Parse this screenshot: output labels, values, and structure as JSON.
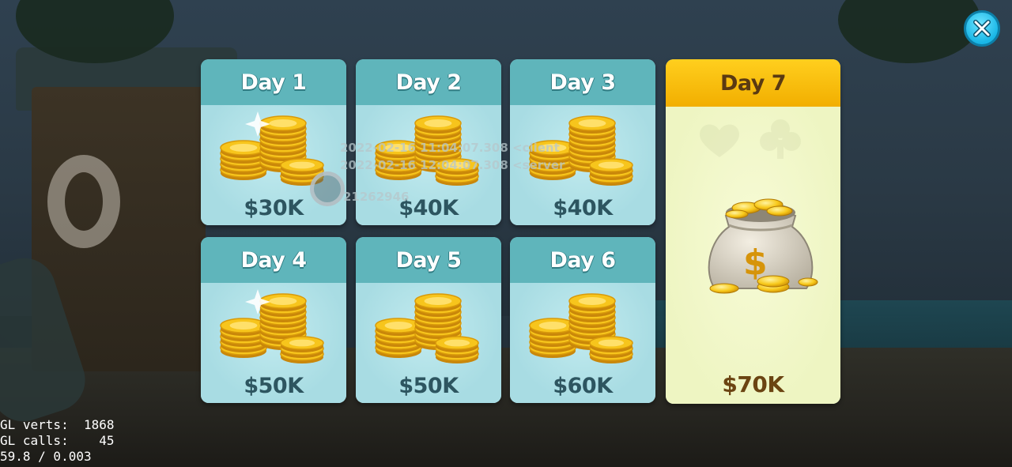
{
  "rewards": [
    {
      "day_label": "Day 1",
      "amount": "$30K"
    },
    {
      "day_label": "Day 2",
      "amount": "$40K"
    },
    {
      "day_label": "Day 3",
      "amount": "$40K"
    },
    {
      "day_label": "Day 4",
      "amount": "$50K"
    },
    {
      "day_label": "Day 5",
      "amount": "$50K"
    },
    {
      "day_label": "Day 6",
      "amount": "$60K"
    }
  ],
  "bonus_reward": {
    "day_label": "Day 7",
    "amount": "$70K"
  },
  "debug": {
    "client_time": "2022-02-16 11:04:07.308 <client",
    "server_time": "2022-02-16 12:04:07.308 <server",
    "user_id": "21262946"
  },
  "gl_stats": {
    "verts_label": "GL verts:",
    "verts_value": "1868",
    "calls_label": "GL calls:",
    "calls_value": "45",
    "fps": "59.8 / 0.003"
  },
  "icons": {
    "close": "close-icon",
    "coins": "coin-stack-icon",
    "money_bag": "money-bag-icon",
    "sparkle": "sparkle-icon"
  },
  "colors": {
    "card_header": "#5fb5bb",
    "card_body": "#a9dde5",
    "bonus_header": "#f7bd0a",
    "bonus_body": "#eef5c2",
    "close_button": "#19b6e6"
  }
}
